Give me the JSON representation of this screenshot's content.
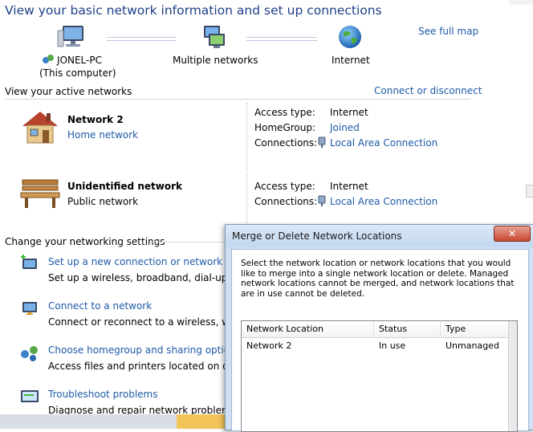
{
  "page": {
    "title": "View your basic network information and set up connections",
    "see_full_map": "See full map"
  },
  "map": {
    "computer_name": "JONEL-PC",
    "computer_sub": "(This computer)",
    "middle_label": "Multiple networks",
    "internet_label": "Internet"
  },
  "active": {
    "heading": "View your active networks",
    "connect_link": "Connect or disconnect",
    "networks": [
      {
        "name": "Network  2",
        "type": "Home network",
        "access_label": "Access type:",
        "access_value": "Internet",
        "homegroup_label": "HomeGroup:",
        "homegroup_value": "Joined",
        "connections_label": "Connections:",
        "connections_value": "Local Area Connection"
      },
      {
        "name": "Unidentified network",
        "type": "Public network",
        "access_label": "Access type:",
        "access_value": "Internet",
        "connections_label": "Connections:",
        "connections_value": "Local Area Connection"
      }
    ]
  },
  "settings": {
    "heading": "Change your networking settings",
    "items": [
      {
        "title": "Set up a new connection or network",
        "desc": "Set up a wireless, broadband, dial-up, ad h"
      },
      {
        "title": "Connect to a network",
        "desc": "Connect or reconnect to a wireless, wired,"
      },
      {
        "title": "Choose homegroup and sharing options",
        "desc": "Access files and printers located on other"
      },
      {
        "title": "Troubleshoot problems",
        "desc": "Diagnose and repair network problems, or"
      }
    ]
  },
  "dialog": {
    "title": "Merge or Delete Network Locations",
    "close_label": "✕",
    "description": "Select the network location or network locations that you would like to merge into a single network location or delete. Managed network locations cannot be merged, and network locations that are in use cannot be deleted.",
    "columns": [
      "Network Location",
      "Status",
      "Type"
    ],
    "rows": [
      {
        "location": "Network  2",
        "status": "In use",
        "type": "Unmanaged"
      }
    ]
  },
  "colors": {
    "link": "#1e5aa8",
    "title": "#1e3f87",
    "close": "#c9452f"
  }
}
